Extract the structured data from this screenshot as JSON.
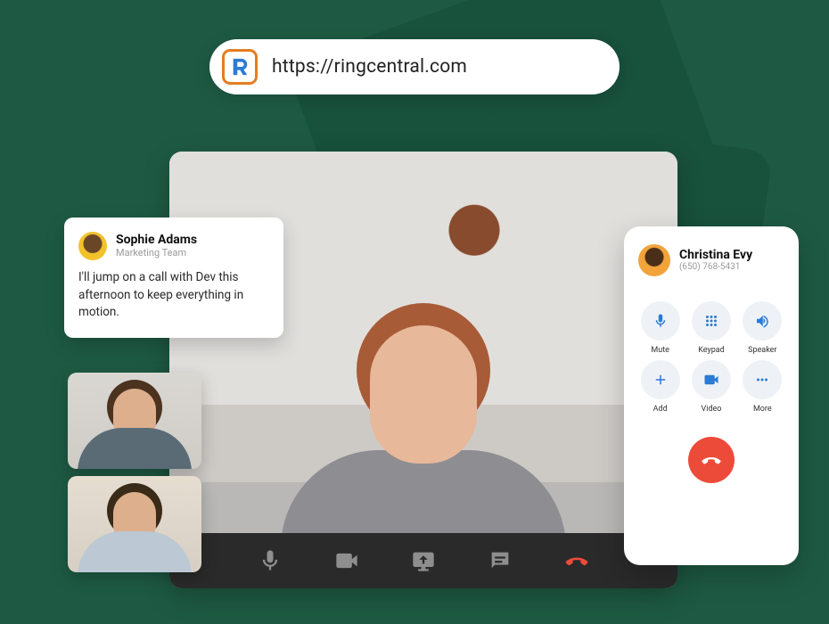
{
  "urlbar": {
    "url": "https://ringcentral.com",
    "logo_name": "ringcentral-logo"
  },
  "comment": {
    "author_name": "Sophie Adams",
    "author_team": "Marketing Team",
    "message": "I'll jump on a call with Dev this afternoon to keep everything in motion."
  },
  "video_toolbar": {
    "mic": "microphone-icon",
    "camera": "video-icon",
    "share": "share-screen-icon",
    "chat": "chat-icon",
    "hangup": "hangup-icon"
  },
  "dialer": {
    "contact_name": "Christina Evy",
    "contact_phone": "(650) 768-5431",
    "buttons": [
      {
        "id": "mute",
        "label": "Mute",
        "icon": "microphone-icon"
      },
      {
        "id": "keypad",
        "label": "Keypad",
        "icon": "keypad-icon"
      },
      {
        "id": "speaker",
        "label": "Speaker",
        "icon": "speaker-icon"
      },
      {
        "id": "add",
        "label": "Add",
        "icon": "plus-icon"
      },
      {
        "id": "video",
        "label": "Video",
        "icon": "video-icon"
      },
      {
        "id": "more",
        "label": "More",
        "icon": "more-icon"
      }
    ],
    "hangup_icon": "hangup-icon"
  }
}
